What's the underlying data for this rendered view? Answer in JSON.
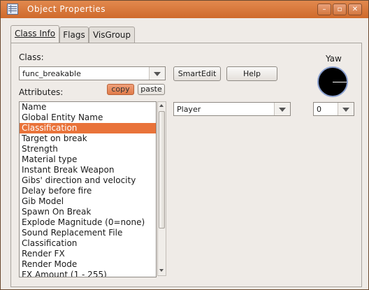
{
  "window": {
    "title": "Object Properties",
    "controls": [
      "minimize-icon",
      "maximize-icon",
      "close-icon"
    ]
  },
  "tabs": [
    {
      "label": "Class Info",
      "active": true
    },
    {
      "label": "Flags",
      "active": false
    },
    {
      "label": "VisGroup",
      "active": false
    }
  ],
  "class": {
    "label": "Class:",
    "value": "func_breakable"
  },
  "buttons": {
    "smartedit": "SmartEdit",
    "help": "Help",
    "copy": "copy",
    "paste": "paste"
  },
  "attributes": {
    "label": "Attributes:",
    "selected_index": 2,
    "items": [
      "Name",
      "Global Entity Name",
      "Classification",
      "Target on break",
      "Strength",
      "Material type",
      "Instant Break Weapon",
      "Gibs' direction and velocity",
      "Delay before fire",
      "Gib Model",
      "Spawn On Break",
      "Explode Magnitude (0=none)",
      "Sound Replacement File",
      "Classification",
      "Render FX",
      "Render Mode",
      "FX Amount (1 - 255)"
    ]
  },
  "value_combo": {
    "value": "Player"
  },
  "yaw": {
    "label": "Yaw",
    "value": "0"
  },
  "colors": {
    "titlebar": "#d9773a",
    "selection": "#e9733a",
    "copy_button": "#e88a5c"
  }
}
